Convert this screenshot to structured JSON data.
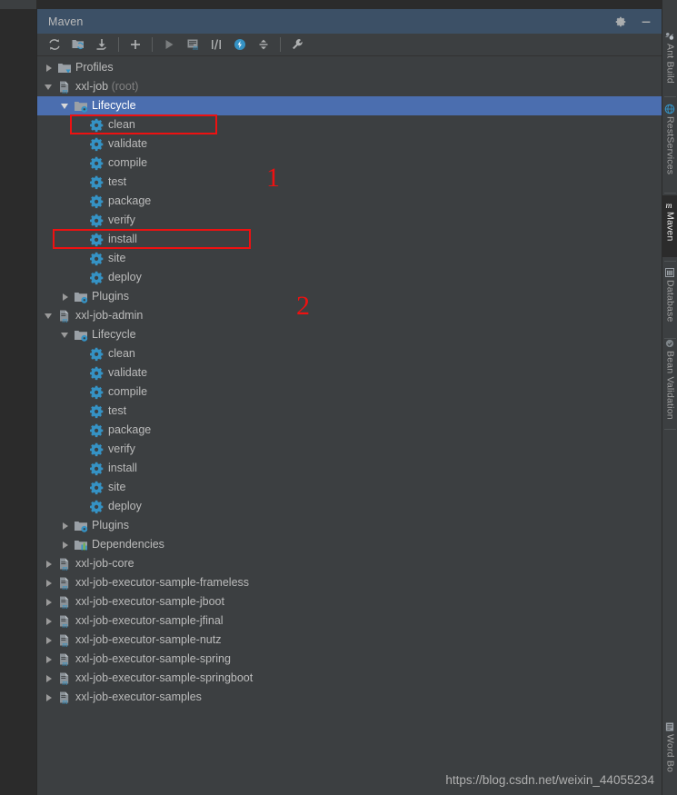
{
  "window": {
    "title": "Maven",
    "settings_label": "Settings",
    "minimize_label": "Hide"
  },
  "toolbar": {
    "buttons": [
      {
        "name": "reimport-all-maven-projects",
        "icon": "refresh-icon",
        "label": "Reimport All Maven Projects"
      },
      {
        "name": "generate-sources-and-update-folders",
        "icon": "folder-refresh-icon",
        "label": "Generate Sources and Update Folders For All Projects"
      },
      {
        "name": "download-sources-and-documentation",
        "icon": "download-icon",
        "label": "Download Sources and/or Documentation"
      },
      {
        "name": "add-maven-project",
        "icon": "plus-icon",
        "label": "Add Maven Projects"
      },
      {
        "name": "run-maven-build",
        "icon": "run-icon",
        "label": "Run Maven Build"
      },
      {
        "name": "execute-maven-goal",
        "icon": "maven-goal-icon",
        "label": "Execute Maven Goal"
      },
      {
        "name": "toggle-offline-mode",
        "icon": "offline-icon",
        "label": "Toggle Offline Mode"
      },
      {
        "name": "toggle-skip-tests-mode",
        "icon": "skip-tests-icon",
        "label": "Toggle 'Skip Tests' Mode"
      },
      {
        "name": "collapse-expand",
        "icon": "collapse-icon",
        "label": "Collapse All"
      },
      {
        "name": "maven-settings",
        "icon": "wrench-icon",
        "label": "Maven Settings"
      }
    ]
  },
  "tree": [
    {
      "label": "Profiles",
      "indent": 0,
      "arrow": "closed",
      "icon": "profiles-folder-icon",
      "name": "tree-node-profiles"
    },
    {
      "label": "xxl-job",
      "suffix": " (root)",
      "indent": 0,
      "arrow": "open",
      "icon": "maven-module-icon",
      "name": "tree-node-xxl-job"
    },
    {
      "label": "Lifecycle",
      "indent": 1,
      "arrow": "open",
      "icon": "lifecycle-folder-icon",
      "selected": true,
      "name": "tree-node-lifecycle-root"
    },
    {
      "label": "clean",
      "indent": 2,
      "arrow": "none",
      "icon": "goal-gear-icon",
      "name": "tree-node-goal-clean"
    },
    {
      "label": "validate",
      "indent": 2,
      "arrow": "none",
      "icon": "goal-gear-icon",
      "name": "tree-node-goal-validate"
    },
    {
      "label": "compile",
      "indent": 2,
      "arrow": "none",
      "icon": "goal-gear-icon",
      "name": "tree-node-goal-compile"
    },
    {
      "label": "test",
      "indent": 2,
      "arrow": "none",
      "icon": "goal-gear-icon",
      "name": "tree-node-goal-test"
    },
    {
      "label": "package",
      "indent": 2,
      "arrow": "none",
      "icon": "goal-gear-icon",
      "name": "tree-node-goal-package"
    },
    {
      "label": "verify",
      "indent": 2,
      "arrow": "none",
      "icon": "goal-gear-icon",
      "name": "tree-node-goal-verify"
    },
    {
      "label": "install",
      "indent": 2,
      "arrow": "none",
      "icon": "goal-gear-icon",
      "name": "tree-node-goal-install"
    },
    {
      "label": "site",
      "indent": 2,
      "arrow": "none",
      "icon": "goal-gear-icon",
      "name": "tree-node-goal-site"
    },
    {
      "label": "deploy",
      "indent": 2,
      "arrow": "none",
      "icon": "goal-gear-icon",
      "name": "tree-node-goal-deploy"
    },
    {
      "label": "Plugins",
      "indent": 1,
      "arrow": "closed",
      "icon": "plugins-folder-icon",
      "name": "tree-node-plugins-root"
    },
    {
      "label": "xxl-job-admin",
      "indent": 0,
      "arrow": "open",
      "icon": "maven-module-icon",
      "name": "tree-node-xxl-job-admin"
    },
    {
      "label": "Lifecycle",
      "indent": 1,
      "arrow": "open",
      "icon": "lifecycle-folder-icon",
      "name": "tree-node-lifecycle-admin"
    },
    {
      "label": "clean",
      "indent": 2,
      "arrow": "none",
      "icon": "goal-gear-icon",
      "name": "tree-node-admin-goal-clean"
    },
    {
      "label": "validate",
      "indent": 2,
      "arrow": "none",
      "icon": "goal-gear-icon",
      "name": "tree-node-admin-goal-validate"
    },
    {
      "label": "compile",
      "indent": 2,
      "arrow": "none",
      "icon": "goal-gear-icon",
      "name": "tree-node-admin-goal-compile"
    },
    {
      "label": "test",
      "indent": 2,
      "arrow": "none",
      "icon": "goal-gear-icon",
      "name": "tree-node-admin-goal-test"
    },
    {
      "label": "package",
      "indent": 2,
      "arrow": "none",
      "icon": "goal-gear-icon",
      "name": "tree-node-admin-goal-package"
    },
    {
      "label": "verify",
      "indent": 2,
      "arrow": "none",
      "icon": "goal-gear-icon",
      "name": "tree-node-admin-goal-verify"
    },
    {
      "label": "install",
      "indent": 2,
      "arrow": "none",
      "icon": "goal-gear-icon",
      "name": "tree-node-admin-goal-install"
    },
    {
      "label": "site",
      "indent": 2,
      "arrow": "none",
      "icon": "goal-gear-icon",
      "name": "tree-node-admin-goal-site"
    },
    {
      "label": "deploy",
      "indent": 2,
      "arrow": "none",
      "icon": "goal-gear-icon",
      "name": "tree-node-admin-goal-deploy"
    },
    {
      "label": "Plugins",
      "indent": 1,
      "arrow": "closed",
      "icon": "plugins-folder-icon",
      "name": "tree-node-admin-plugins"
    },
    {
      "label": "Dependencies",
      "indent": 1,
      "arrow": "closed",
      "icon": "dependencies-icon",
      "name": "tree-node-admin-dependencies"
    },
    {
      "label": "xxl-job-core",
      "indent": 0,
      "arrow": "closed",
      "icon": "maven-module-icon",
      "name": "tree-node-xxl-job-core"
    },
    {
      "label": "xxl-job-executor-sample-frameless",
      "indent": 0,
      "arrow": "closed",
      "icon": "maven-module-icon",
      "name": "tree-node-sample-frameless"
    },
    {
      "label": "xxl-job-executor-sample-jboot",
      "indent": 0,
      "arrow": "closed",
      "icon": "maven-module-icon",
      "name": "tree-node-sample-jboot"
    },
    {
      "label": "xxl-job-executor-sample-jfinal",
      "indent": 0,
      "arrow": "closed",
      "icon": "maven-module-icon",
      "name": "tree-node-sample-jfinal"
    },
    {
      "label": "xxl-job-executor-sample-nutz",
      "indent": 0,
      "arrow": "closed",
      "icon": "maven-module-icon",
      "name": "tree-node-sample-nutz"
    },
    {
      "label": "xxl-job-executor-sample-spring",
      "indent": 0,
      "arrow": "closed",
      "icon": "maven-module-icon",
      "name": "tree-node-sample-spring"
    },
    {
      "label": "xxl-job-executor-sample-springboot",
      "indent": 0,
      "arrow": "closed",
      "icon": "maven-module-icon",
      "name": "tree-node-sample-springboot"
    },
    {
      "label": "xxl-job-executor-samples",
      "indent": 0,
      "arrow": "closed",
      "icon": "maven-module-icon",
      "name": "tree-node-sample-samples"
    }
  ],
  "annotations": [
    {
      "number": "1",
      "target": "clean"
    },
    {
      "number": "2",
      "target": "install"
    }
  ],
  "watermark": "https://blog.csdn.net/weixin_44055234",
  "sidebar": {
    "tabs": [
      {
        "label": "Ant Build",
        "icon": "ant-icon",
        "active": false,
        "name": "sidebar-tab-ant-build"
      },
      {
        "label": "RestServices",
        "icon": "rest-icon",
        "active": false,
        "name": "sidebar-tab-restservices"
      },
      {
        "label": "Maven",
        "icon": "maven-icon",
        "active": true,
        "name": "sidebar-tab-maven"
      },
      {
        "label": "Database",
        "icon": "database-icon",
        "active": false,
        "name": "sidebar-tab-database"
      },
      {
        "label": "Bean Validation",
        "icon": "bean-icon",
        "active": false,
        "name": "sidebar-tab-bean-validation"
      },
      {
        "label": "Word Bo",
        "icon": "word-icon",
        "active": false,
        "name": "sidebar-tab-word-bo"
      }
    ]
  },
  "colors": {
    "panel_bg": "#3c3f41",
    "editor_bg": "#2b2b2b",
    "title_bg": "#3c5066",
    "selection": "#4b6eaf",
    "text": "#bbbbbb",
    "accent_cyan": "#3592c4",
    "annotation_red": "#ee1111"
  }
}
